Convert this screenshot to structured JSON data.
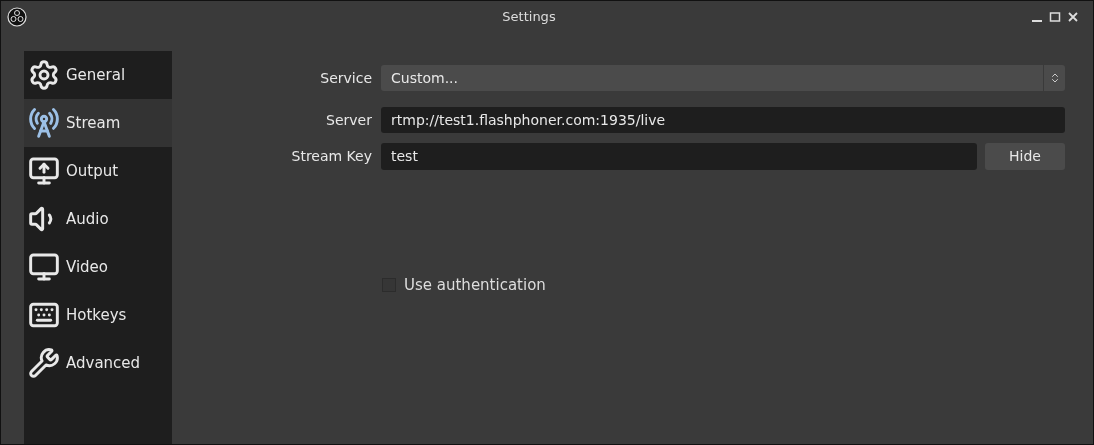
{
  "window": {
    "title": "Settings"
  },
  "sidebar": {
    "items": [
      {
        "label": "General",
        "selected": false
      },
      {
        "label": "Stream",
        "selected": true
      },
      {
        "label": "Output",
        "selected": false
      },
      {
        "label": "Audio",
        "selected": false
      },
      {
        "label": "Video",
        "selected": false
      },
      {
        "label": "Hotkeys",
        "selected": false
      },
      {
        "label": "Advanced",
        "selected": false
      }
    ]
  },
  "form": {
    "service": {
      "label": "Service",
      "value": "Custom..."
    },
    "server": {
      "label": "Server",
      "value": "rtmp://test1.flashphoner.com:1935/live"
    },
    "stream_key": {
      "label": "Stream Key",
      "value": "test",
      "button": "Hide"
    },
    "use_authentication": {
      "label": "Use authentication",
      "checked": false
    }
  }
}
